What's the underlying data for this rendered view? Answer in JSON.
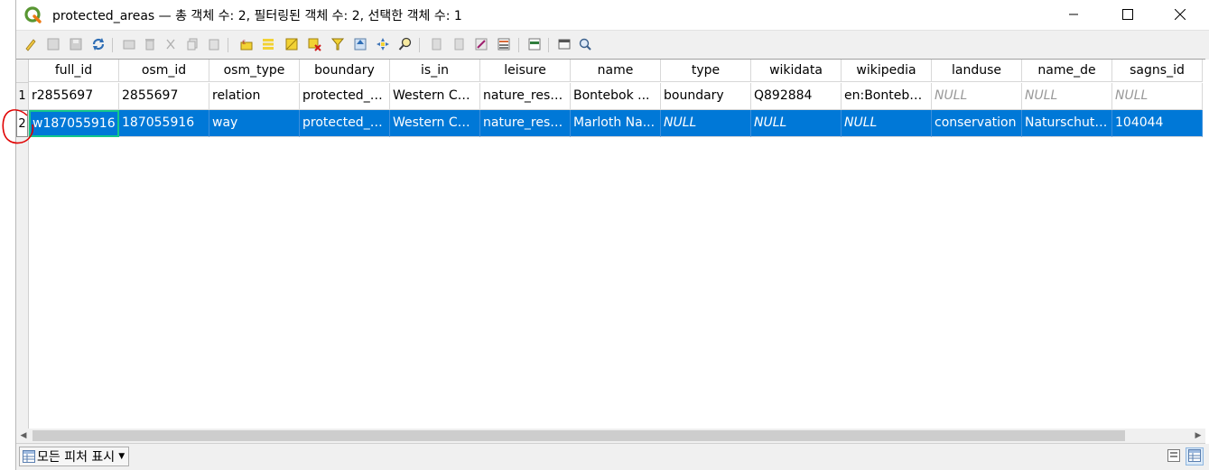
{
  "window": {
    "title": "protected_areas — 총 객체 수: 2, 필터링된 객체 수: 2, 선택한 객체 수: 1",
    "app_icon": "qgis-icon",
    "controls": [
      "minimize-icon",
      "maximize-icon",
      "close-icon"
    ]
  },
  "toolbar": {
    "icons": [
      "toggle-editing-icon",
      "multi-edit-icon",
      "save-edits-icon",
      "reload-icon",
      "add-feature-icon",
      "delete-feature-icon",
      "cut-icon",
      "copy-icon",
      "paste-icon",
      "select-by-expression-icon",
      "select-all-icon",
      "invert-selection-icon",
      "deselect-all-icon",
      "filter-select-icon",
      "move-selection-top-icon",
      "pan-to-selection-icon",
      "zoom-to-selection-icon",
      "new-field-icon",
      "delete-field-icon",
      "field-calculator-icon",
      "conditional-formatting-icon",
      "dock-icon",
      "actions-icon",
      "form-icon"
    ]
  },
  "table": {
    "columns": [
      "full_id",
      "osm_id",
      "osm_type",
      "boundary",
      "is_in",
      "leisure",
      "name",
      "type",
      "wikidata",
      "wikipedia",
      "landuse",
      "name_de",
      "sagns_id"
    ],
    "rows": [
      {
        "num": "1",
        "cells": [
          "r2855697",
          "2855697",
          "relation",
          "protected_a...",
          "Western Ca...",
          "nature_rese...",
          "Bontebok ...",
          "boundary",
          "Q892884",
          "en:Bontebo...",
          "NULL",
          "NULL",
          "NULL"
        ]
      },
      {
        "num": "2",
        "cells": [
          "w187055916",
          "187055916",
          "way",
          "protected_a...",
          "Western Ca...",
          "nature_rese...",
          "Marloth Na...",
          "NULL",
          "NULL",
          "NULL",
          "conservation",
          "Naturschutz...",
          "104044"
        ]
      }
    ],
    "selected_row": 2,
    "focused_cell": "full_id",
    "selection_color": "#0078d7",
    "focus_color": "#14c88a",
    "null_color": "#999999"
  },
  "footer": {
    "filter_label": "모든 피처 표시",
    "view_icons": [
      "form-view-icon",
      "table-view-icon"
    ],
    "active_view": "table-view-icon"
  },
  "annotation": {
    "shape": "red-circle-icon",
    "color": "#e00000"
  }
}
